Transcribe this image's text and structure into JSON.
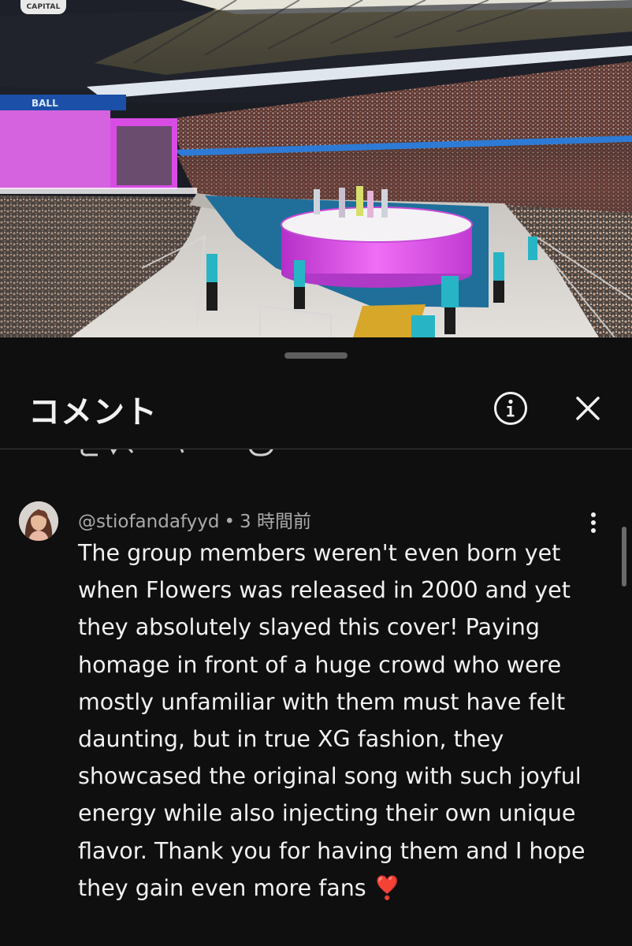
{
  "video": {
    "channel_logo": "CAPITAL",
    "scene": "stadium-concert-stage"
  },
  "sheet": {
    "title": "コメント",
    "icons": {
      "info": "info-icon",
      "close": "close-icon",
      "more": "more-vert-icon"
    }
  },
  "comment": {
    "author": "@stiofandafyyd",
    "separator": "•",
    "time": "3 時間前",
    "text": "The group members weren't even born yet when Flowers was released in 2000 and yet they absolutely slayed this cover! Paying homage in front of a huge crowd who were mostly unfamiliar with them must have felt daunting, but in true XG fashion, they showcased the original song with such joyful energy while also injecting their own unique flavor. Thank you for having them and I hope they gain even more fans ❣️"
  },
  "colors": {
    "background": "#0f0f0f",
    "primary_text": "#f1f1f1",
    "secondary_text": "#aaaaaa",
    "stage_magenta": "#e040e8"
  }
}
